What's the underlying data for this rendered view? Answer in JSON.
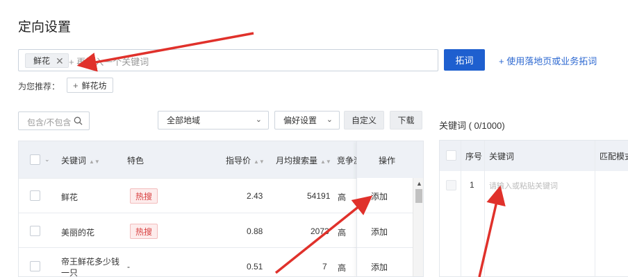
{
  "page": {
    "title": "定向设置"
  },
  "keyword_input": {
    "tag_label": "鲜花",
    "placeholder": "+ 再输入一个关键词"
  },
  "actions": {
    "expand_button": "拓词",
    "landing_link": "+ 使用落地页或业务拓词"
  },
  "recommend": {
    "label": "为您推荐：",
    "chip": "鲜花坊"
  },
  "filters": {
    "include_placeholder": "包含/不包含",
    "region": "全部地域",
    "preference": "偏好设置",
    "custom_button": "自定义",
    "download_button": "下载"
  },
  "table": {
    "headers": {
      "keyword": "关键词",
      "feature": "特色",
      "price": "指导价",
      "search_volume": "月均搜索量",
      "competition": "竞争激",
      "operation": "操作"
    },
    "rows": [
      {
        "keyword": "鲜花",
        "keyword_line2": "",
        "feature": "热搜",
        "price": "2.43",
        "volume": "54191",
        "competition": "高",
        "action": "添加"
      },
      {
        "keyword": "美丽的花",
        "keyword_line2": "",
        "feature": "热搜",
        "price": "0.88",
        "volume": "2073",
        "competition": "高",
        "action": "添加"
      },
      {
        "keyword": "帝王鲜花多少钱",
        "keyword_line2": "一只",
        "feature": "-",
        "price": "0.51",
        "volume": "7",
        "competition": "高",
        "action": "添加"
      }
    ]
  },
  "selected": {
    "title": "关键词 ( 0/1000)",
    "headers": {
      "index": "序号",
      "keyword": "关键词",
      "match": "匹配模式"
    },
    "first_row_index": "1",
    "first_row_placeholder": "请输入或粘贴关键词"
  },
  "colors": {
    "primary": "#1e5fcf",
    "link": "#2c68d1",
    "hot_text": "#d84040",
    "hot_bg": "#fdecec",
    "annotation_arrow": "#e0312b"
  },
  "icons": {
    "tag_close": "close-icon",
    "search": "search-icon",
    "chevron": "chevron-down-icon",
    "sort": "sort-icon"
  }
}
